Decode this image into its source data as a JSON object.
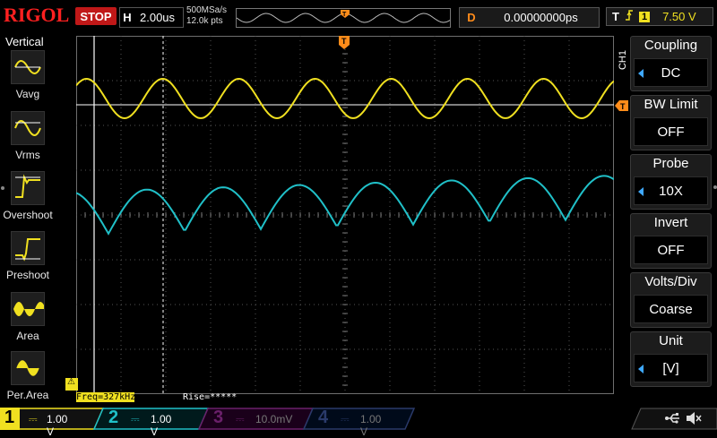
{
  "header": {
    "logo": "RIGOL",
    "run_state": "STOP",
    "horizontal": {
      "label": "H",
      "value": "2.00us"
    },
    "sample_rate": "500MSa/s",
    "memory_depth": "12.0k pts",
    "delay": {
      "label": "D",
      "value": "0.00000000ps"
    },
    "trigger": {
      "label": "T",
      "channel": "1",
      "level": "7.50 V"
    }
  },
  "left_menu": {
    "title": "Vertical",
    "items": [
      {
        "label": "Vavg",
        "icon": "vavg-icon"
      },
      {
        "label": "Vrms",
        "icon": "vrms-icon"
      },
      {
        "label": "Overshoot",
        "icon": "overshoot-icon"
      },
      {
        "label": "Preshoot",
        "icon": "preshoot-icon"
      },
      {
        "label": "Area",
        "icon": "area-icon"
      },
      {
        "label": "Per.Area",
        "icon": "per-area-icon"
      }
    ]
  },
  "right_menu": {
    "channel_tag": "CH1",
    "items": [
      {
        "title": "Coupling",
        "value": "DC",
        "has_arrow": true
      },
      {
        "title": "BW Limit",
        "value": "OFF",
        "has_arrow": false
      },
      {
        "title": "Probe",
        "value": "10X",
        "has_arrow": true
      },
      {
        "title": "Invert",
        "value": "OFF",
        "has_arrow": false
      },
      {
        "title": "Volts/Div",
        "value": "Coarse",
        "has_arrow": false
      },
      {
        "title": "Unit",
        "value": "[V]",
        "has_arrow": true
      }
    ]
  },
  "measurements": {
    "freq": "Freq=327kHz",
    "rise": "Rise=*****"
  },
  "markers": {
    "trigger_position": "T",
    "trigger_level": "T",
    "cursor_marker": "⚠"
  },
  "channels": [
    {
      "num": "1",
      "scale": "1.00 V",
      "color": "#f0e020",
      "active": true
    },
    {
      "num": "2",
      "scale": "1.00 V",
      "color": "#20c0c8",
      "active": false
    },
    {
      "num": "3",
      "scale": "10.0mV",
      "color": "#c030c0",
      "active": false
    },
    {
      "num": "4",
      "scale": "1.00 V",
      "color": "#3070e0",
      "active": false
    }
  ],
  "colors": {
    "ch1": "#f0e020",
    "ch2": "#20c0c8",
    "ch3": "#c030c0",
    "ch4": "#3070e0",
    "trigger": "#ff8c1a",
    "accent": "#3fa9ff",
    "stop": "#c01818",
    "logo": "#ff2020"
  }
}
